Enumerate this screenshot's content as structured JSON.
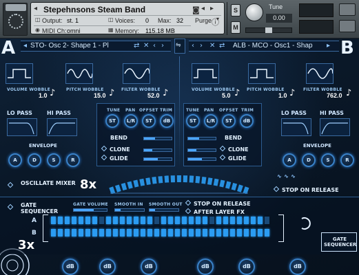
{
  "header": {
    "instrument_name": "Stepehnsons Steam Band",
    "output_label": "Output:",
    "output_value": "st. 1",
    "voices_label": "Voices:",
    "voices_value": "0",
    "max_label": "Max:",
    "max_value": "32",
    "purge_label": "Purge",
    "midi_label": "MIDI Ch:",
    "midi_value": "omni",
    "memory_label": "Memory:",
    "memory_value": "115.18 MB",
    "solo_label": "S",
    "mute_label": "M",
    "tune_label": "Tune",
    "tune_value": "0.00"
  },
  "sources": {
    "a": {
      "letter": "A",
      "name": "STO- Osc 2- Shape 1 - Pl"
    },
    "b": {
      "letter": "B",
      "name": "ALB - MCO - Osc1 - Shap"
    }
  },
  "mod_labels": {
    "volume": "VOLUME WOBBLE",
    "pitch": "PITCH WOBBLE",
    "filter": "FILTER WOBBLE"
  },
  "a_values": {
    "volume": "1.0",
    "pitch": "15.0",
    "filter": "52.0"
  },
  "b_values": {
    "volume": "5.0",
    "pitch": "1.0",
    "filter": "762.0"
  },
  "filters": {
    "lo": "LO PASS",
    "hi": "HI PASS",
    "envelope": "ENVELOPE"
  },
  "adsr": [
    "A",
    "D",
    "S",
    "R"
  ],
  "mix": {
    "tune": "TUNE",
    "pan": "PAN",
    "offset": "OFFSET",
    "trim": "TRIM",
    "knobs": [
      "ST",
      "L/R",
      "ST",
      "dB"
    ],
    "bend": "BEND",
    "clone": "CLONE",
    "glide": "GLIDE"
  },
  "oscillate": {
    "label": "OSCILLATE MIXER",
    "multiplier": "8x",
    "stop_on_release": "STOP ON RELEASE"
  },
  "gate": {
    "label": "GATE SEQUENCER",
    "volume": "GATE VOLUME",
    "smooth_in": "SMOOTH IN",
    "smooth_out": "SMOOTH OUT",
    "stop_on_release": "STOP ON RELEASE",
    "after_layer_fx": "AFTER LAYER FX",
    "rows": [
      "A",
      "B"
    ],
    "multiplier": "3x",
    "badge": "GATE SEQUENCER"
  },
  "bottom_knobs": [
    "dB",
    "dB",
    "dB",
    "dB",
    "dB",
    "dB"
  ],
  "colors": {
    "accent": "#2b9cf2",
    "panel_border": "#2c5c90",
    "header": "#4c5458"
  }
}
